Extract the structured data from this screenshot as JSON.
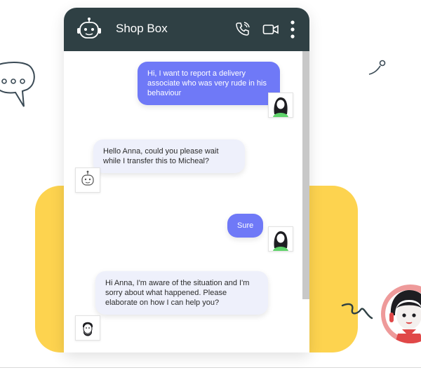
{
  "chat": {
    "title": "Shop Box",
    "messages": [
      {
        "from": "user",
        "text": "Hi, I want to report a delivery associate who was very rude in his behaviour"
      },
      {
        "from": "bot",
        "text": "Hello Anna, could you please wait while I transfer this to Micheal?"
      },
      {
        "from": "user",
        "text": "Sure"
      },
      {
        "from": "agent",
        "text": "Hi Anna, I'm aware of the situation and I'm sorry about what happened. Please elaborate on how I can help you?"
      }
    ]
  },
  "icons": {
    "header_logo": "robot-icon",
    "call": "phone-call-icon",
    "video": "video-camera-icon",
    "menu": "vertical-dots-icon"
  },
  "colors": {
    "header": "#2f4044",
    "outgoing_bubble": "#6f79f7",
    "incoming_bubble": "#eef0fb",
    "accent_panel": "#fdd34f"
  }
}
